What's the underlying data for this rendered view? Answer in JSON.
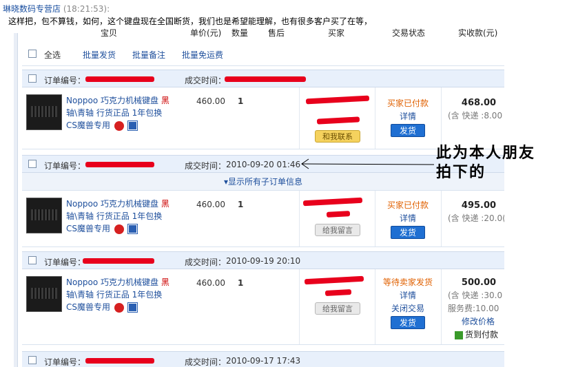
{
  "chat": {
    "shop_name": "琳晓数码专营店",
    "timestamp": "(18:21:53):",
    "message": "这样把，包不算钱，如何，这个键盘现在全国断货，我们也是希望能理解，也有很多客户买了在等，"
  },
  "columns": {
    "item": "宝贝",
    "unit_price": "单价(元)",
    "qty": "数量",
    "after_sale": "售后",
    "buyer": "买家",
    "status": "交易状态",
    "paid": "实收款(元)"
  },
  "toolbar": {
    "select_all": "全选",
    "bulk_ship": "批量发货",
    "bulk_note": "批量备注",
    "bulk_free_ship": "批量免运费"
  },
  "labels": {
    "order_no": "订单编号：",
    "deal_time": "成交时间：",
    "expand_sub": "▾显示所有子订单信息"
  },
  "orders": [
    {
      "time": "",
      "title_a": "Noppoo 巧克力机械键盘 ",
      "title_b": "黑",
      "title_c": "轴\\青轴 行货正品 1年包换",
      "title_d": "CS魔兽专用",
      "price": "460.00",
      "qty": "1",
      "contact": "和我联系",
      "status": "买家已付款",
      "detail": "详情",
      "ship": "发货",
      "amount": "468.00",
      "shipping": "(含 快递 :8.00"
    },
    {
      "time": "2010-09-20 01:46",
      "title_a": "Noppoo 巧克力机械键盘 ",
      "title_b": "黑",
      "title_c": "轴\\青轴 行货正品 1年包换",
      "title_d": "CS魔兽专用",
      "price": "460.00",
      "qty": "1",
      "contact": "给我留言",
      "status": "买家已付款",
      "detail": "详情",
      "ship": "发货",
      "amount": "495.00",
      "shipping": "(含 快递 :20.0("
    },
    {
      "time": "2010-09-19 20:10",
      "title_a": "Noppoo 巧克力机械键盘 ",
      "title_b": "黑",
      "title_c": "轴\\青轴 行货正品 1年包换",
      "title_d": "CS魔兽专用",
      "price": "460.00",
      "qty": "1",
      "contact": "给我留言",
      "status": "等待卖家发货",
      "detail": "详情",
      "close": "关闭交易",
      "ship": "发货",
      "amount": "500.00",
      "shipping": "(含 快递 :30.0",
      "service_fee": "服务费:10.00",
      "modify_price": "修改价格",
      "cod": "货到付款"
    },
    {
      "time": "2010-09-17 17:43"
    }
  ],
  "annotation": {
    "line1": "此为本人朋友",
    "line2": "拍下的"
  },
  "colors": {
    "link": "#1e4f9c",
    "status_orange": "#e06000",
    "redaction": "#e8001c",
    "ship_button": "#1f6fd2",
    "order_header_bg": "#e8f0fb"
  }
}
